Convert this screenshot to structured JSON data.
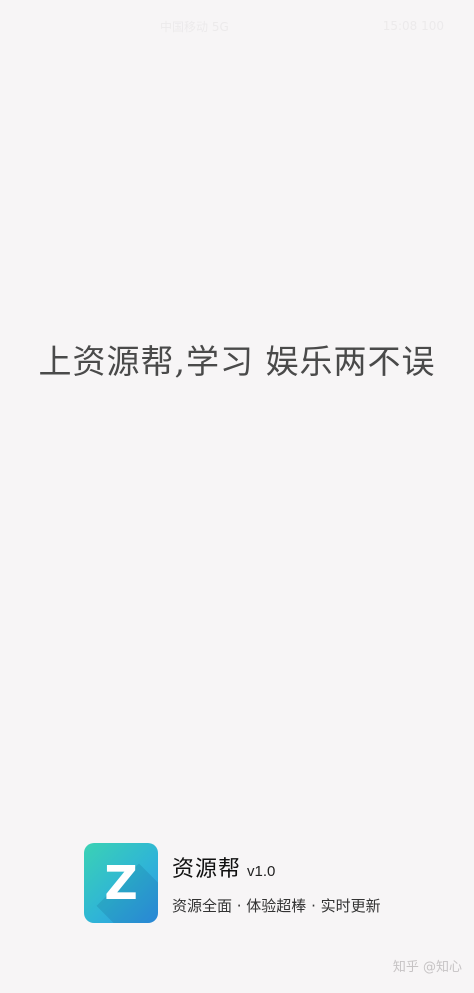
{
  "status_bar": {
    "left_text": "中国移动 5G",
    "right_text": "15:08 100"
  },
  "splash": {
    "slogan": "上资源帮,学习 娱乐两不误"
  },
  "brand": {
    "logo_letter": "Z",
    "app_name": "资源帮",
    "version": "v1.0",
    "tagline": "资源全面 · 体验超棒 · 实时更新"
  },
  "watermark": {
    "text": "知乎 @知心"
  },
  "colors": {
    "background": "#f7f5f6",
    "slogan_text": "#4a4a4a",
    "logo_gradient_start": "#3bd2b4",
    "logo_gradient_end": "#2f94e8"
  }
}
